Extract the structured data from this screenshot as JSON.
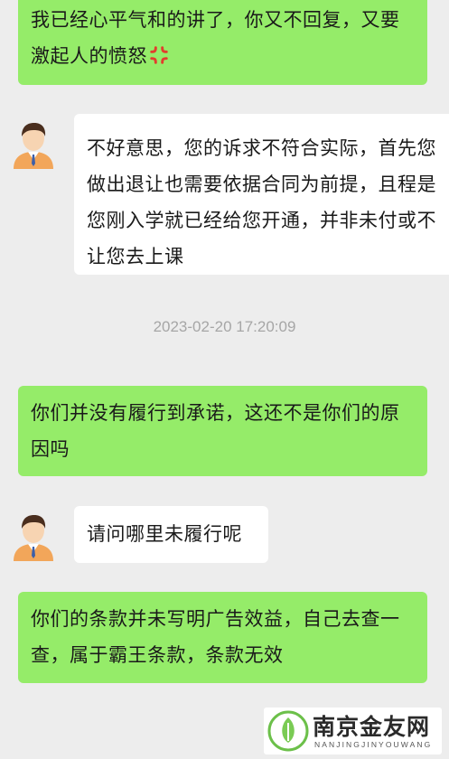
{
  "messages": [
    {
      "text": "我已经心平气和的讲了，你又不回复，又要激起人的愤怒",
      "emoji": "anger-symbol-icon"
    },
    {
      "text": "不好意思，您的诉求不符合实际，首先您做出退让也需要依据合同为前提，且程是您刚入学就已经给您开通，并非未付或不让您去上课"
    },
    {
      "text": "你们并没有履行到承诺，这还不是你们的原因吗"
    },
    {
      "text": "请问哪里未履行呢"
    },
    {
      "text": "你们的条款并未写明广告效益，自己去查一查，属于霸王条款，条款无效"
    }
  ],
  "timestamp": "2023-02-20 17:20:09",
  "watermark": {
    "title": "南京金友网",
    "subtitle": "NANJINGJINYOUWANG"
  },
  "colors": {
    "sent_bubble": "#95ec69",
    "received_bubble": "#ffffff",
    "background": "#ededed"
  }
}
